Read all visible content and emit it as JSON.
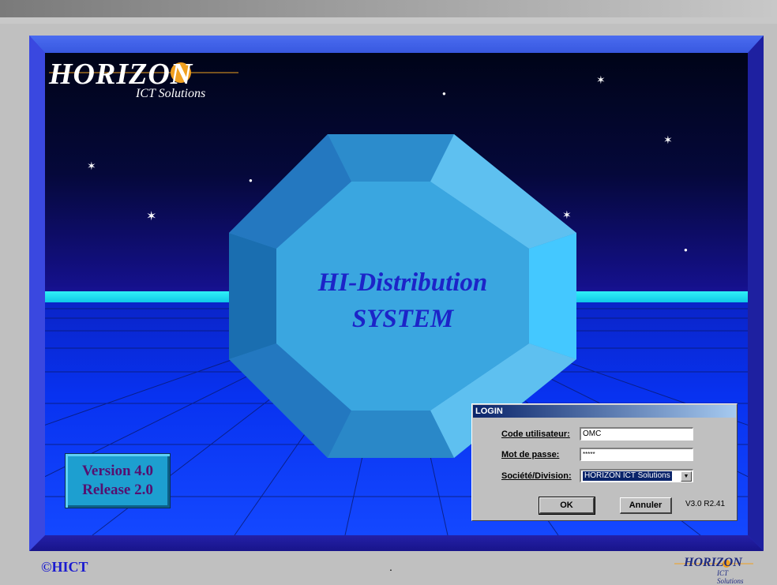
{
  "app": {
    "brand": "HORIZON",
    "brand_sub": "ICT Solutions",
    "title_line1": "HI-Distribution",
    "title_line2": "SYSTEM",
    "version_line1": "Version 4.0",
    "version_line2": "Release 2.0",
    "copyright": "©HICT",
    "status_dot": ".",
    "mini_brand": "HORIZON",
    "mini_brand_sub": "ICT Solutions"
  },
  "login": {
    "title": "LOGIN",
    "user_label": "Code utilisateur:",
    "user_value": "OMC",
    "password_label": "Mot de passe:",
    "password_value": "*****",
    "company_label": "Société/Division:",
    "company_value": "HORIZON ICT Solutions",
    "ok_label": "OK",
    "cancel_label": "Annuler",
    "version_note": "V3.0 R2.41"
  },
  "colors": {
    "frame": "#2a2ad8",
    "horizon": "#30f0f8",
    "octagon": "#3aa0d8",
    "title_text": "#1c24c8",
    "version_box": "#1d9fd0",
    "copyright": "#1a1ad0"
  },
  "icons": {
    "dropdown": "chevron-down-icon",
    "star": "star-icon"
  }
}
